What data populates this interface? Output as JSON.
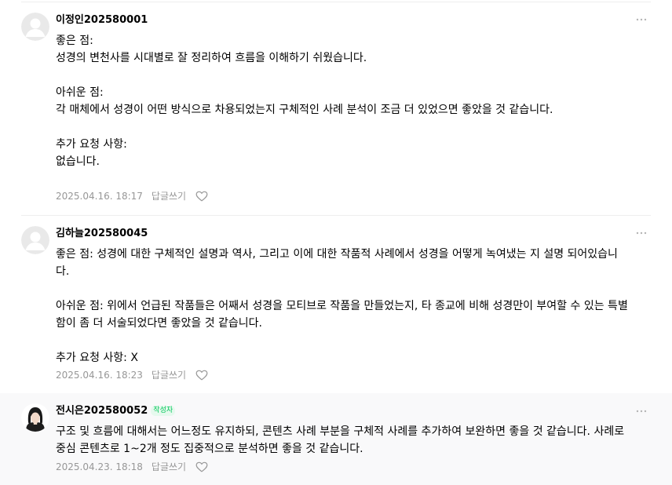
{
  "comments": [
    {
      "nickname": "이정인202580001",
      "body": "좋은 점:\n성경의 변천사를 시대별로 잘 정리하여 흐름을 이해하기 쉬웠습니다.\n\n아쉬운 점:\n각 매체에서 성경이 어떤 방식으로 차용되었는지 구체적인 사례 분석이 조금 더 있었으면 좋았을 것 같습니다.\n\n추가 요청 사항:\n없습니다.",
      "date": "2025.04.16. 18:17",
      "reply_label": "답글쓰기",
      "avatar_icon": "default-avatar-icon"
    },
    {
      "nickname": "김하늘202580045",
      "body": "좋은 점: 성경에 대한 구체적인 설명과 역사, 그리고 이에 대한 작품적 사례에서 성경을 어떻게 녹여냈는 지 설명 되어있습니다.\n\n아쉬운 점: 위에서 언급된 작품들은 어째서 성경을 모티브로 작품을 만들었는지, 타 종교에 비해 성경만이 부여할 수 있는 특별함이 좀 더 서술되었다면 좋았을 것 같습니다.\n\n추가 요청 사항: X",
      "date": "2025.04.16. 18:23",
      "reply_label": "답글쓰기",
      "avatar_icon": "default-avatar-icon"
    },
    {
      "nickname": "전시은202580052",
      "badge": "작성자",
      "body": "구조 및 흐름에 대해서는 어느정도 유지하되, 콘텐츠 사례 부분을 구체적 사례를 추가하여 보완하면 좋을 것 같습니다. 사례로 중심 콘텐츠로 1~2개 정도 집중적으로 분석하면 좋을 것 같습니다.",
      "date": "2025.04.23. 18:18",
      "reply_label": "답글쓰기",
      "avatar_icon": "profile-photo-icon"
    }
  ],
  "colors": {
    "meta_text": "#979797",
    "badge_text": "#03c75a",
    "badge_bg": "#e6f9ee",
    "author_row_bg": "#f9f9fa",
    "divider": "#eeeeee"
  },
  "icons": {
    "more": "more-dots-icon",
    "like": "heart-outline-icon"
  }
}
